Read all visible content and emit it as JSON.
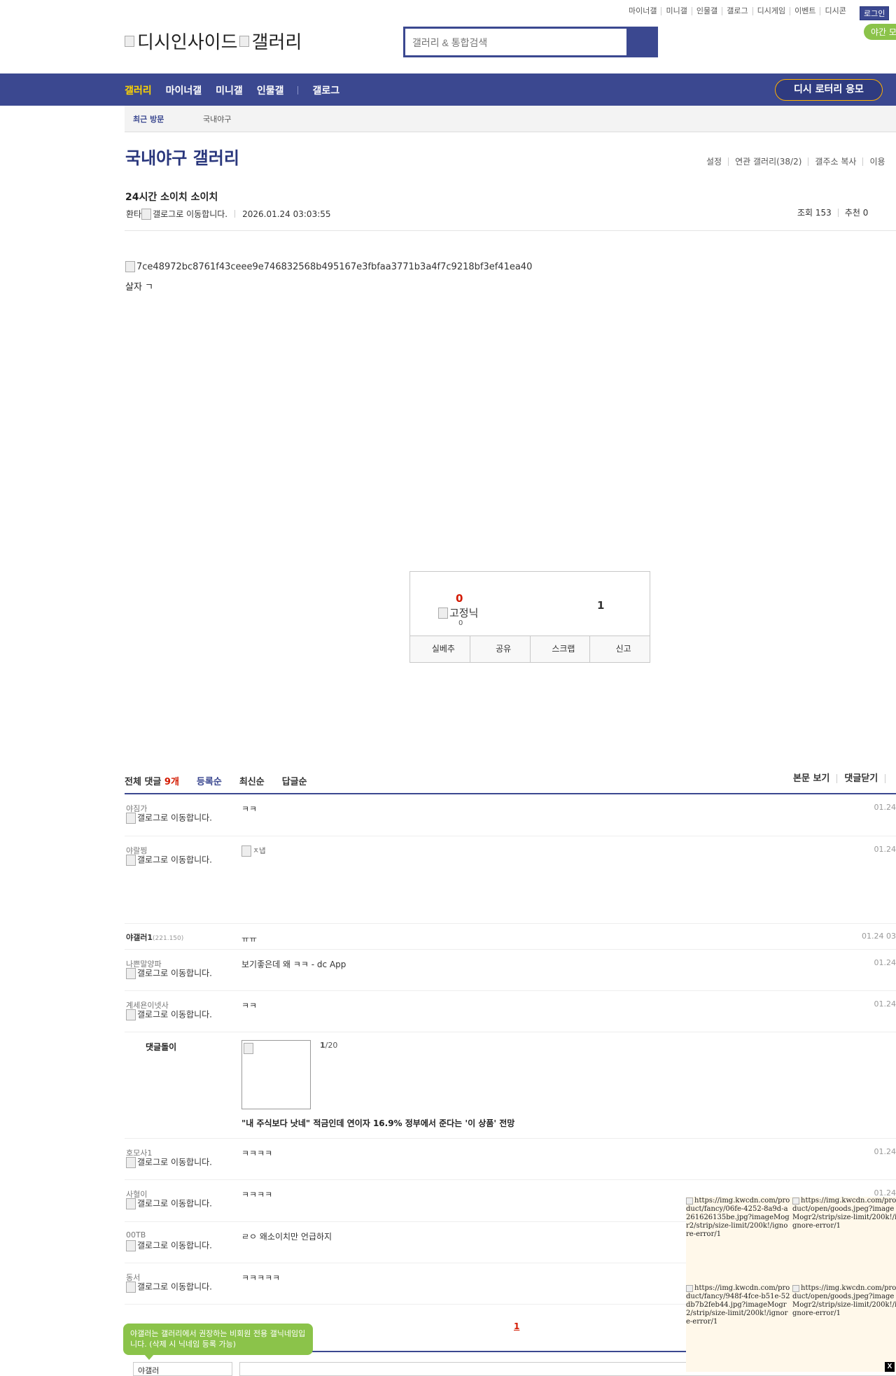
{
  "top_links": [
    "마이너갤",
    "미니갤",
    "인물갤",
    "갤로그",
    "디시게임",
    "이벤트",
    "디시콘"
  ],
  "login_label": "로그인",
  "night_label": "야간 모",
  "logo": {
    "alt1": "디시인사이드",
    "alt2": "갤러리"
  },
  "search": {
    "placeholder": "갤러리 & 통합검색"
  },
  "nav": {
    "items": [
      "갤러리",
      "마이너갤",
      "미니갤",
      "인물갤"
    ],
    "extra": "갤로그",
    "lottery": "디시 로터리 응모"
  },
  "recent": {
    "label": "최근 방문",
    "item": "국내야구"
  },
  "gallery": {
    "title": "국내야구 갤러리",
    "menu": [
      "설정",
      "연관 갤러리(38/2)",
      "갤주소 복사",
      "이용"
    ]
  },
  "post": {
    "title": "24시간 소이치 소이치",
    "writer": "환타",
    "writer_img_alt": "갤로그로 이동합니다.",
    "date": "2026.01.24 03:03:55",
    "views": "조회 153",
    "recommend": "추천 0",
    "image_alt": "7ce48972bc8761f43ceee9e746832568b495167e3fbfaa3771b3a4f7c9218bf3ef41ea40",
    "body": "살자 ㄱ"
  },
  "vote": {
    "up": "0",
    "fixnick": "고정닉",
    "up_fixed": "0",
    "down": "1",
    "buttons": [
      "실베추",
      "공유",
      "스크랩",
      "신고"
    ]
  },
  "comments_header": {
    "total_label": "전체 댓글",
    "total_count": "9개",
    "sorts": [
      "등록순",
      "최신순",
      "답글순"
    ],
    "right": [
      "본문 보기",
      "댓글닫기"
    ]
  },
  "comments": [
    {
      "nick": "야짐가",
      "galog": "갤로그로 이동합니다.",
      "text": "ㅋㅋ",
      "date": "01.24"
    },
    {
      "nick": "야랄찡",
      "galog": "갤로그로 이동합니다.",
      "text": "",
      "img_alt": "ㅈ냅",
      "date": "01.24"
    },
    {
      "nick_main": "야갤러",
      "nick_num": "1",
      "nick_ip": "(221.150)",
      "text": "ㅠㅠ",
      "date": "01.24 03"
    },
    {
      "nick": "나쁜말양파",
      "galog": "갤로그로 이동합니다.",
      "text": "보기좋은데 왜 ㅋㅋ - dc App",
      "date": "01.24"
    },
    {
      "nick": "계세욘이넷사",
      "galog": "갤로그로 이동합니다.",
      "text": "ㅋㅋ",
      "date": "01.24"
    },
    {
      "nick": "호모사1",
      "galog": "갤로그로 이동합니다.",
      "text": "ㅋㅋㅋㅋ",
      "date": "01.24"
    },
    {
      "nick": "사혈이",
      "galog": "갤로그로 이동합니다.",
      "text": "ㅋㅋㅋㅋ",
      "date": "01.24"
    },
    {
      "nick": "00TB",
      "galog": "갤로그로 이동합니다.",
      "text": "ㄹㅇ 왜소이치만 언급하지",
      "date": ""
    },
    {
      "nick": "동서",
      "galog": "갤로그로 이동합니다.",
      "text": "ㅋㅋㅋㅋㅋ",
      "date": ""
    }
  ],
  "ad": {
    "label": "댓글돌이",
    "counter_current": "1",
    "counter_total": "/20",
    "title": "\"내 주식보다 낫네\" 적금인데 연이자 16.9% 정부에서 준다는 '이 상품' 전망"
  },
  "page_number": "1",
  "tooltip": "야갤러는 갤러리에서 권장하는 비회원 전용 갤닉네임입니다. (삭제 시 닉네임 등록 가능)",
  "nick_input_value": "야갤러",
  "float_ad": {
    "cells": [
      "https://img.kwcdn.com/product/fancy/06fe-4252-8a9d-a261626135be.jpg?imageMogr2/strip/size-limit/200k!/ignore-error/1",
      "https://img.kwcdn.com/product/open/goods.jpeg?imageMogr2/strip/size-limit/200k!/ignore-error/1",
      "https://img.kwcdn.com/product/fancy/948f-4fce-b51e-52db7b2feb44.jpg?imageMogr2/strip/size-limit/200k!/ignore-error/1",
      "https://img.kwcdn.com/product/open/goods.jpeg?imageMogr2/strip/size-limit/200k!/ignore-error/1"
    ],
    "close": "X"
  },
  "colors": {
    "brand": "#3b4890",
    "accent_yellow": "#ffd400",
    "green": "#8bc34a",
    "red": "#d31900"
  }
}
